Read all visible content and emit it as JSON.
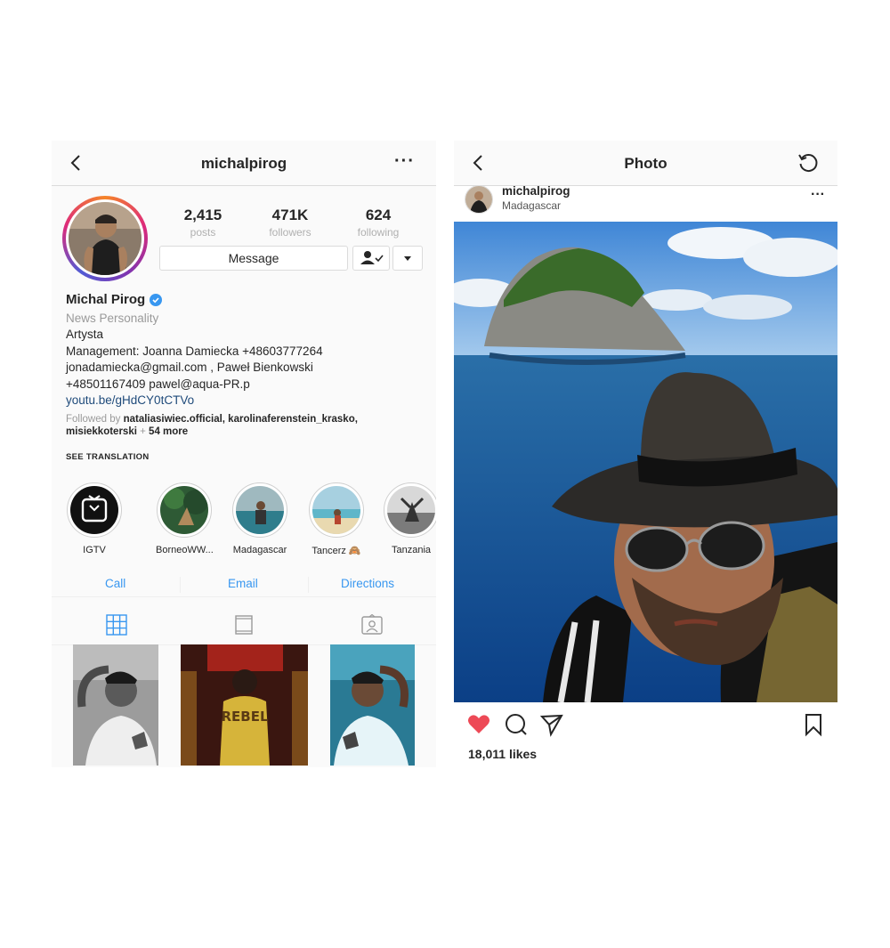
{
  "profile": {
    "nav": {
      "title": "michalpirog"
    },
    "stats": [
      {
        "value": "2,415",
        "label": "posts"
      },
      {
        "value": "471K",
        "label": "followers"
      },
      {
        "value": "624",
        "label": "following"
      }
    ],
    "message_label": "Message",
    "name": "Michal Pirog",
    "category": "News Personality",
    "bio_lines": [
      "Artysta",
      "Management: Joanna Damiecka +48603777264",
      "jonadamiecka@gmail.com , Paweł Bienkowski",
      "+48501167409 pawel@aqua-PR.p"
    ],
    "link": "youtu.be/gHdCY0tCTVo",
    "followed_by": {
      "prefix": "Followed by",
      "users": "nataliasiwiec.official, karolinaferenstein_krasko,",
      "users2": "misiekkoterski",
      "joiner": "+",
      "more": "54 more"
    },
    "see_translation": "SEE TRANSLATION",
    "highlights": [
      {
        "label": "IGTV"
      },
      {
        "label": "BorneoWW..."
      },
      {
        "label": "Madagascar"
      },
      {
        "label": "Tancerz 🙈"
      },
      {
        "label": "Tanzania"
      }
    ],
    "contacts": {
      "call": "Call",
      "email": "Email",
      "directions": "Directions"
    },
    "grid_posts": [
      {
        "text": ""
      },
      {
        "text": "REBEL"
      },
      {
        "text": ""
      }
    ]
  },
  "post": {
    "nav": {
      "title": "Photo"
    },
    "username": "michalpirog",
    "location": "Madagascar",
    "likes": "18,011 likes"
  },
  "colors": {
    "accent": "#3897f0",
    "like": "#ed4956",
    "verified": "#3897f0"
  },
  "icons": [
    "back-icon",
    "more-icon",
    "refresh-icon",
    "verified-icon",
    "follow-check-icon",
    "chevron-down-icon",
    "grid-icon",
    "igtv-icon",
    "tagged-icon",
    "heart-icon",
    "comment-icon",
    "share-icon",
    "bookmark-icon"
  ]
}
